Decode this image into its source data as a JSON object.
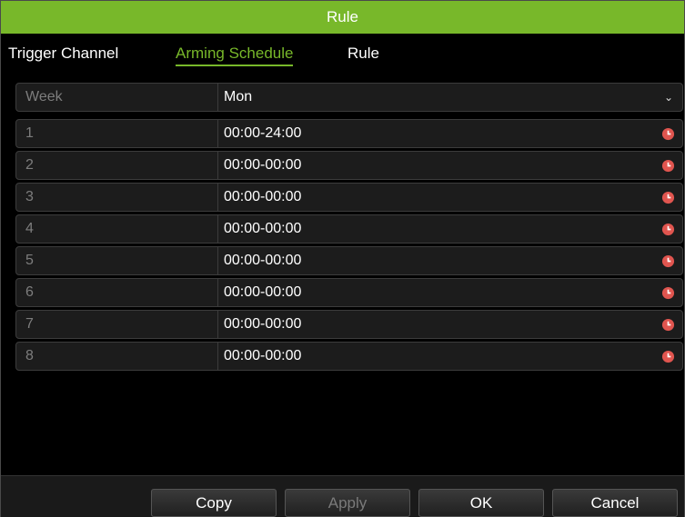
{
  "window": {
    "title": "Rule"
  },
  "tabs": [
    {
      "label": "Trigger Channel",
      "active": false
    },
    {
      "label": "Arming Schedule",
      "active": true
    },
    {
      "label": "Rule",
      "active": false
    }
  ],
  "week": {
    "label": "Week",
    "value": "Mon"
  },
  "schedule": [
    {
      "index": "1",
      "time": "00:00-24:00"
    },
    {
      "index": "2",
      "time": "00:00-00:00"
    },
    {
      "index": "3",
      "time": "00:00-00:00"
    },
    {
      "index": "4",
      "time": "00:00-00:00"
    },
    {
      "index": "5",
      "time": "00:00-00:00"
    },
    {
      "index": "6",
      "time": "00:00-00:00"
    },
    {
      "index": "7",
      "time": "00:00-00:00"
    },
    {
      "index": "8",
      "time": "00:00-00:00"
    }
  ],
  "buttons": {
    "copy": "Copy",
    "apply": "Apply",
    "ok": "OK",
    "cancel": "Cancel"
  },
  "colors": {
    "accent": "#78b82a",
    "clock_icon": "#e0554f"
  },
  "icons": {
    "time_picker": "clock-icon",
    "dropdown": "chevron-down-icon"
  }
}
